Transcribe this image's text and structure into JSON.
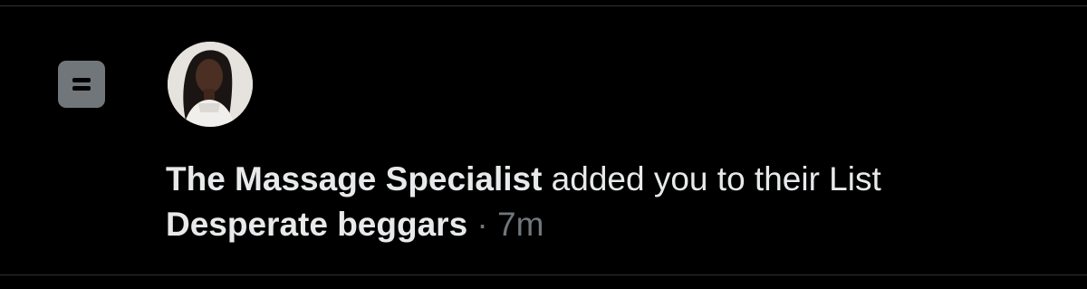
{
  "notification": {
    "icon": "list-icon",
    "avatar": "user-avatar",
    "actor_name": "The Massage Specialist",
    "action_text": " added you to their List",
    "list_name": "Desperate beggars",
    "separator": " · ",
    "time": "7m"
  },
  "colors": {
    "background": "#000000",
    "primary_text": "#e7e9ea",
    "secondary_text": "#71767b",
    "divider": "#2f3336"
  }
}
